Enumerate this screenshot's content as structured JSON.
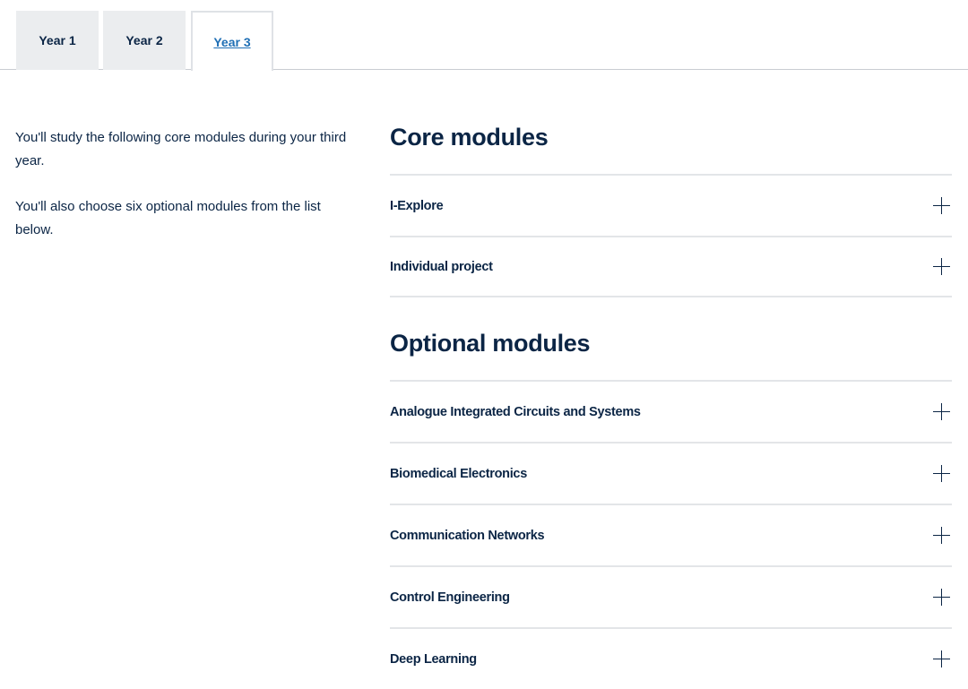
{
  "tabs": [
    {
      "label": "Year 1",
      "active": false
    },
    {
      "label": "Year 2",
      "active": false
    },
    {
      "label": "Year 3",
      "active": true
    }
  ],
  "intro": {
    "paragraph1": "You'll study the following core modules during your third year.",
    "paragraph2": "You'll also choose six optional modules from the list below."
  },
  "core": {
    "heading": "Core modules",
    "modules": [
      {
        "label": "I-Explore",
        "icon": "plus-icon"
      },
      {
        "label": "Individual project",
        "icon": "plus-icon"
      }
    ]
  },
  "optional": {
    "heading": "Optional modules",
    "modules": [
      {
        "label": "Analogue Integrated Circuits and Systems",
        "icon": "plus-icon"
      },
      {
        "label": "Biomedical Electronics",
        "icon": "plus-icon"
      },
      {
        "label": "Communication Networks",
        "icon": "plus-icon"
      },
      {
        "label": "Control Engineering",
        "icon": "plus-icon"
      },
      {
        "label": "Deep Learning",
        "icon": "plus-icon"
      }
    ]
  },
  "colors": {
    "text": "#0b2545",
    "active_tab_link": "#1f6fb5",
    "tab_background": "#ebedef",
    "divider": "#e3e5e8"
  }
}
